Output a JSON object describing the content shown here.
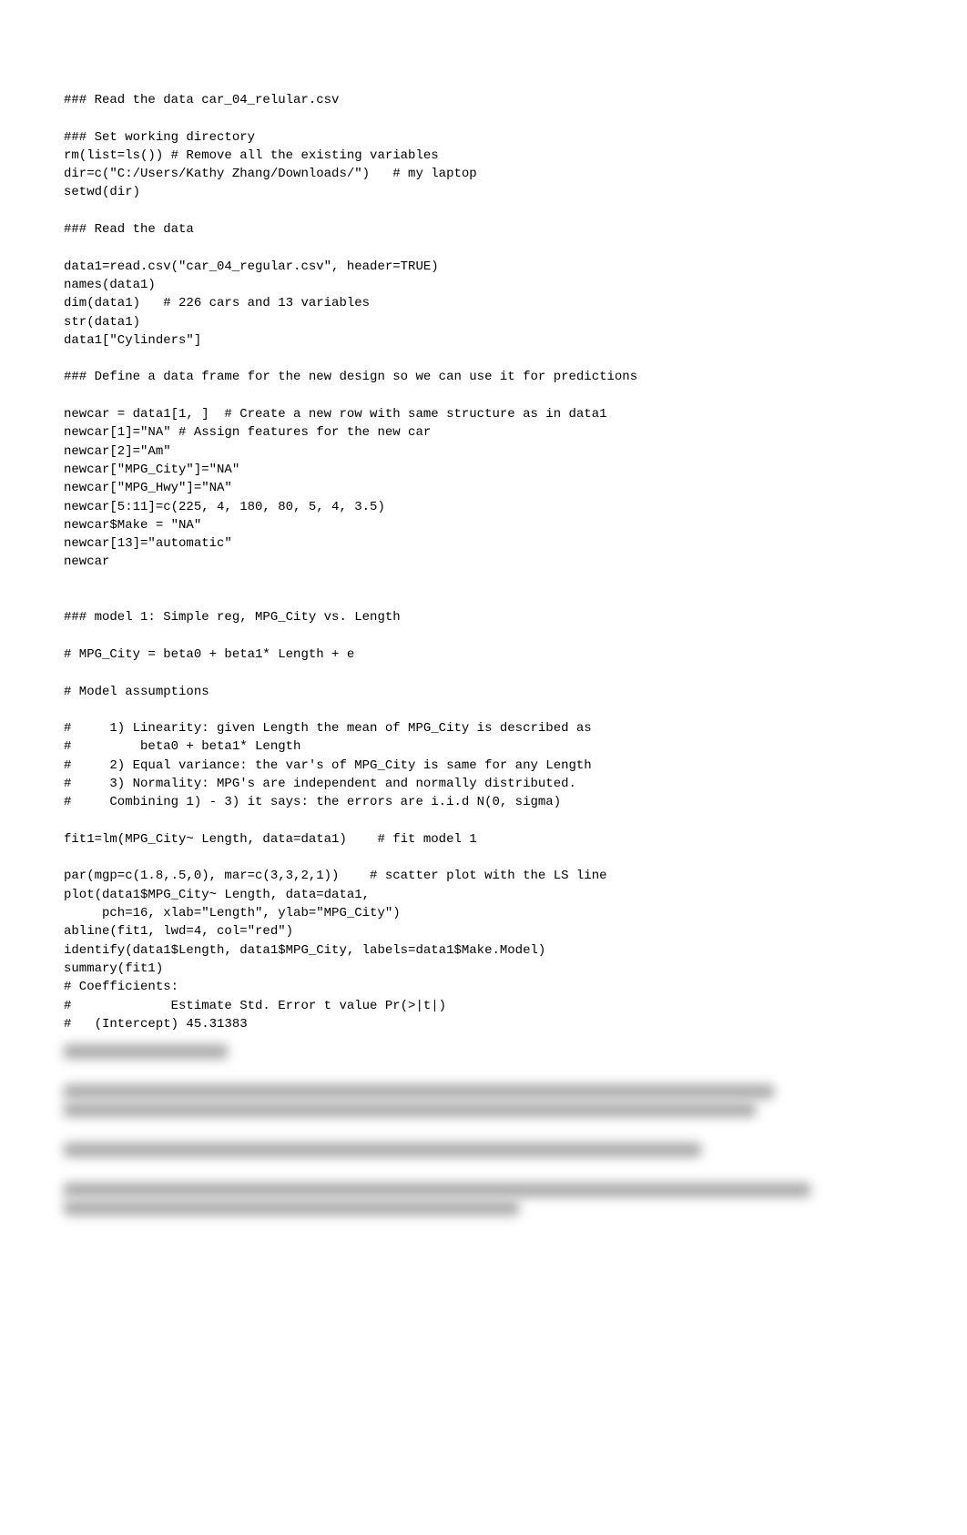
{
  "code": {
    "lines": [
      "### Read the data car_04_relular.csv",
      "",
      "### Set working directory",
      "rm(list=ls()) # Remove all the existing variables",
      "dir=c(\"C:/Users/Kathy Zhang/Downloads/\")   # my laptop",
      "setwd(dir)",
      "",
      "### Read the data",
      "",
      "data1=read.csv(\"car_04_regular.csv\", header=TRUE)",
      "names(data1)",
      "dim(data1)   # 226 cars and 13 variables",
      "str(data1)",
      "data1[\"Cylinders\"]",
      "",
      "### Define a data frame for the new design so we can use it for predictions",
      "",
      "newcar = data1[1, ]  # Create a new row with same structure as in data1",
      "newcar[1]=\"NA\" # Assign features for the new car",
      "newcar[2]=\"Am\"",
      "newcar[\"MPG_City\"]=\"NA\"",
      "newcar[\"MPG_Hwy\"]=\"NA\"",
      "newcar[5:11]=c(225, 4, 180, 80, 5, 4, 3.5)",
      "newcar$Make = \"NA\"",
      "newcar[13]=\"automatic\"",
      "newcar",
      "",
      "",
      "### model 1: Simple reg, MPG_City vs. Length",
      "",
      "# MPG_City = beta0 + beta1* Length + e",
      "",
      "# Model assumptions",
      "",
      "#     1) Linearity: given Length the mean of MPG_City is described as",
      "#         beta0 + beta1* Length",
      "#     2) Equal variance: the var's of MPG_City is same for any Length",
      "#     3) Normality: MPG's are independent and normally distributed.",
      "#     Combining 1) - 3) it says: the errors are i.i.d N(0, sigma)",
      "",
      "fit1=lm(MPG_City~ Length, data=data1)    # fit model 1",
      "",
      "par(mgp=c(1.8,.5,0), mar=c(3,3,2,1))    # scatter plot with the LS line",
      "plot(data1$MPG_City~ Length, data=data1,",
      "     pch=16, xlab=\"Length\", ylab=\"MPG_City\")",
      "abline(fit1, lwd=4, col=\"red\")",
      "identify(data1$Length, data1$MPG_City, labels=data1$Make.Model)",
      "summary(fit1)",
      "# Coefficients:",
      "#             Estimate Std. Error t value Pr(>|t|)",
      "#   (Intercept) 45.31383"
    ]
  }
}
